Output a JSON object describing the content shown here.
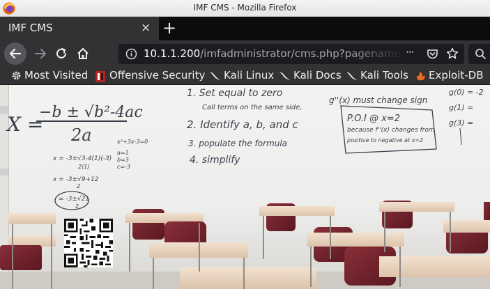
{
  "window": {
    "title": "IMF CMS - Mozilla Firefox"
  },
  "tab": {
    "title": "IMF CMS",
    "close": "×",
    "new_tab": "+"
  },
  "nav": {
    "url_host": "10.1.1.200",
    "url_path": "/imfadministrator/cms.php?pagename",
    "more_label": "···"
  },
  "bookmarks": [
    {
      "label": "Most Visited",
      "icon": "gear-icon"
    },
    {
      "label": "Offensive Security",
      "icon": "offsec-icon"
    },
    {
      "label": "Kali Linux",
      "icon": "kali-dragon-icon"
    },
    {
      "label": "Kali Docs",
      "icon": "kali-dragon-icon"
    },
    {
      "label": "Kali Tools",
      "icon": "kali-dragon-icon"
    },
    {
      "label": "Exploit-DB",
      "icon": "exploitdb-icon"
    }
  ],
  "whiteboard": {
    "formula": "x = -b ± √(b²-4ac) / 2a",
    "formula_num": "−b ± √b²-4ac",
    "formula_den": "2a",
    "formula_x": "X =",
    "steps": [
      "1. Set equal to zero",
      "Call terms on the same side,",
      "2. Identify a, b, and c",
      "3. populate the formula",
      "4. simplify"
    ],
    "side_note": "g''(x) must change sign",
    "poi_box": [
      "P.O.I @ x=2",
      "because f''(x) changes from",
      "positive to negative at x=2"
    ],
    "right_col": [
      "g(0) = -2",
      "g(1) =",
      "g(3) ="
    ],
    "abc_values": [
      "a=1",
      "b=3",
      "c=-3"
    ],
    "eq_left": [
      "x = -3±√3-4(1)(-3)",
      "2(1)",
      "x = -3±√9+12",
      "2",
      "= -3±√21",
      "2"
    ],
    "eq_small": "x²+3x-3=0"
  },
  "colors": {
    "tab_bg": "#323234",
    "titlebar_bg": "#e4e4e4",
    "chair_red": "#7a2530"
  }
}
